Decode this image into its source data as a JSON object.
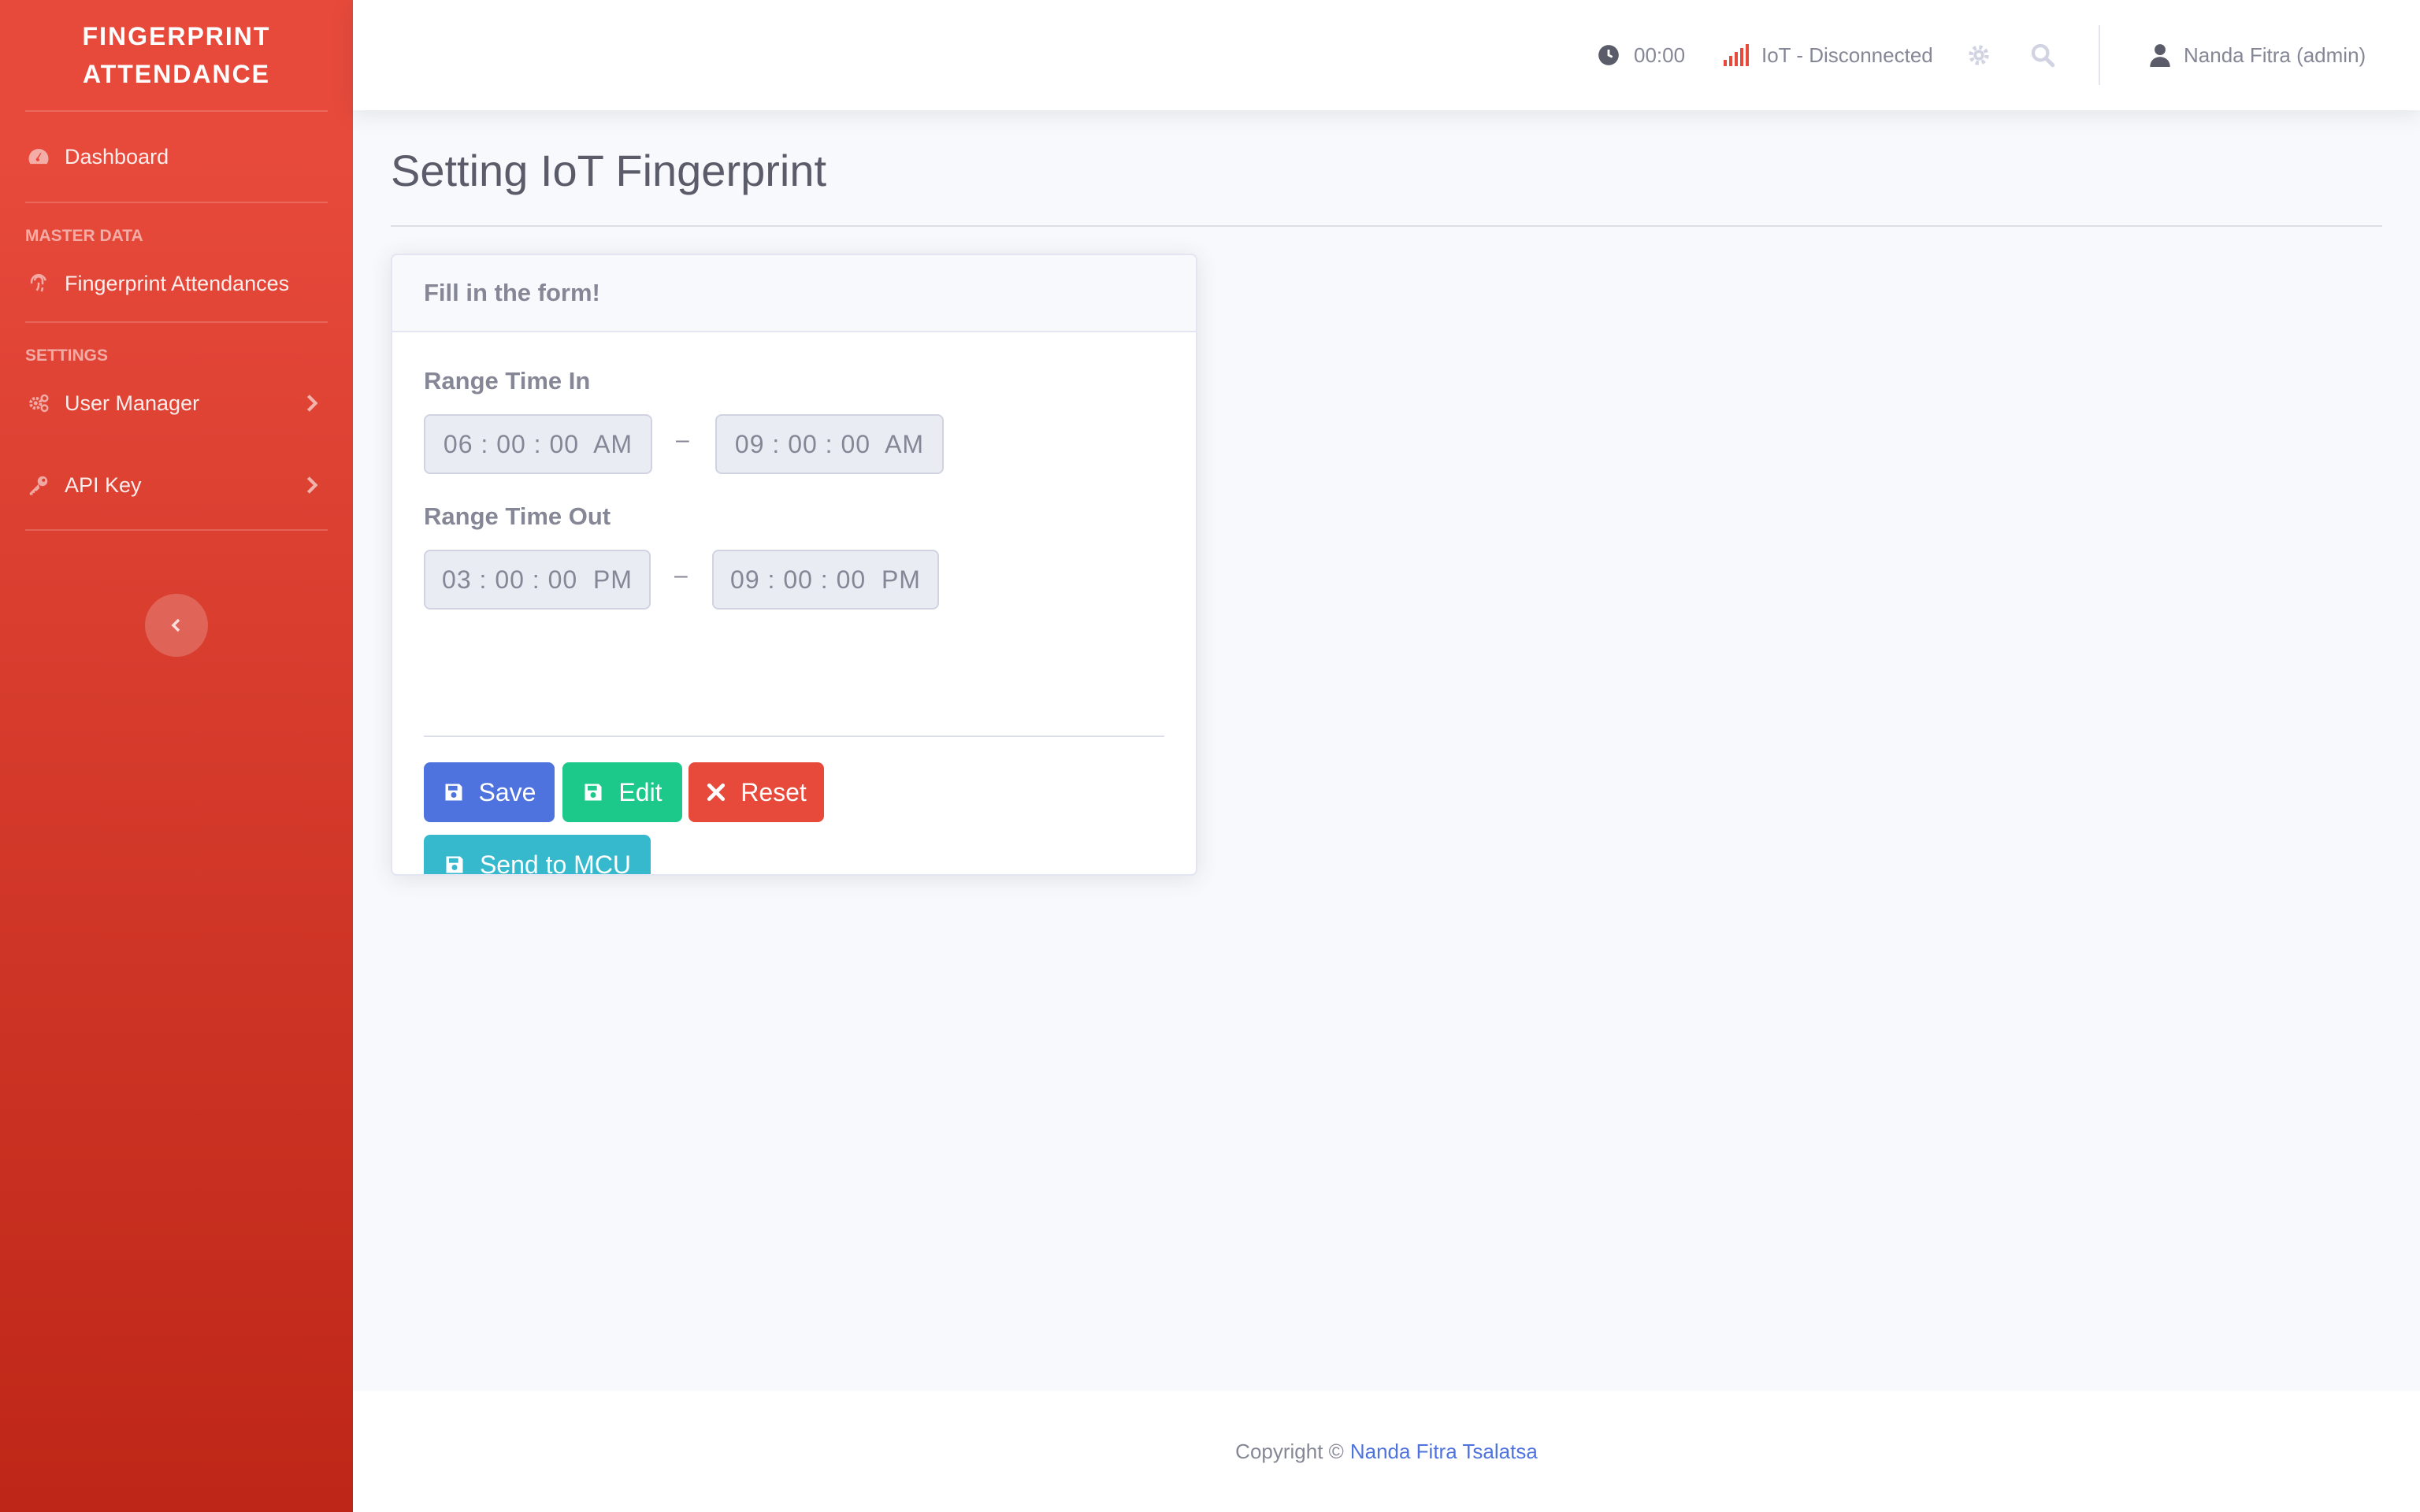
{
  "sidebar": {
    "brand_line1": "FINGERPRINT",
    "brand_line2": "ATTENDANCE",
    "dashboard": "Dashboard",
    "heading_master": "MASTER DATA",
    "fingerprint_attendances": "Fingerprint Attendances",
    "heading_settings": "SETTINGS",
    "user_manager": "User Manager",
    "api_key": "API Key"
  },
  "topbar": {
    "clock": "00:00",
    "iot_status": "IoT - Disconnected",
    "user": "Nanda Fitra (admin)",
    "status_color": "#e74a3b"
  },
  "page": {
    "title": "Setting IoT Fingerprint"
  },
  "form": {
    "header": "Fill in the form!",
    "range_in_label": "Range Time In",
    "time_in_start": "06 : 00 : 00  AM",
    "time_in_end": "09 : 00 : 00  AM",
    "range_out_label": "Range Time Out",
    "time_out_start": "03 : 00 : 00  PM",
    "time_out_end": "09 : 00 : 00  PM",
    "separator": "–",
    "save": "Save",
    "edit": "Edit",
    "reset": "Reset",
    "send": "Send to MCU"
  },
  "footer": {
    "copyright": "Copyright ©",
    "author": "Nanda Fitra Tsalatsa"
  },
  "colors": {
    "primary": "#4e73df",
    "success": "#1cc88a",
    "danger": "#e74a3b",
    "info": "#36b9cc"
  }
}
